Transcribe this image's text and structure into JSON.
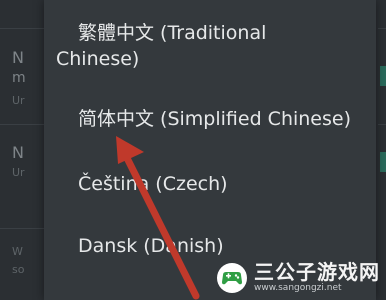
{
  "background": {
    "rows": [
      {
        "big": "N",
        "sub": "m",
        "small": "Ur"
      },
      {
        "big": "N",
        "sub": "",
        "small": "Ur"
      },
      {
        "big": "",
        "sub": "W",
        "small": "so"
      }
    ]
  },
  "dialog": {
    "items": [
      {
        "label_line1": "繁體中文 (Traditional",
        "label_line2": "Chinese)"
      },
      {
        "label": "简体中文 (Simplified Chinese)"
      },
      {
        "label": "Čeština (Czech)"
      },
      {
        "label": "Dansk (Danish)"
      }
    ]
  },
  "annotation": {
    "arrow_color": "#c0392b"
  },
  "watermark": {
    "title": "三公子游戏网",
    "url": "www.sangongzi.net",
    "logo_color": "#2f9e44"
  }
}
